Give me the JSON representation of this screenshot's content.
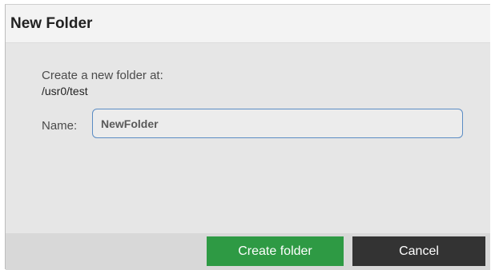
{
  "dialog": {
    "title": "New Folder",
    "prompt": "Create a new folder at:",
    "path": "/usr0/test",
    "name_label": "Name:",
    "name_value": "NewFolder"
  },
  "buttons": {
    "create_label": "Create folder",
    "cancel_label": "Cancel"
  },
  "colors": {
    "create_button": "#2e9a44",
    "cancel_button": "#333333",
    "input_focus_border": "#5b8cc4"
  }
}
